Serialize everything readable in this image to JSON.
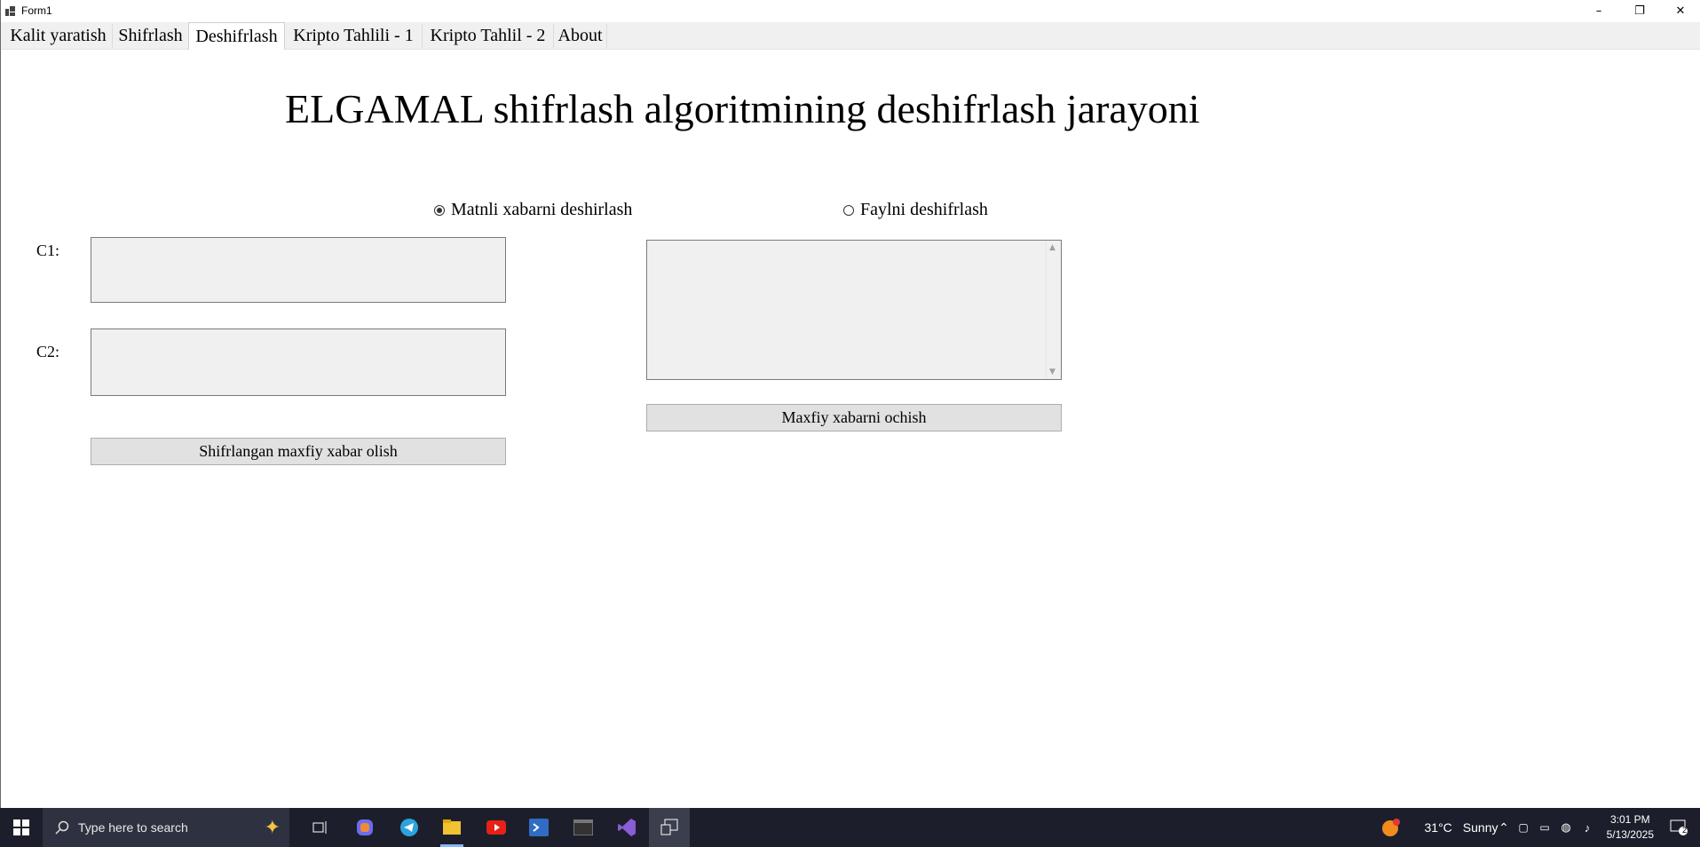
{
  "window": {
    "title": "Form1",
    "controls": {
      "minimize": "–",
      "restore": "❐",
      "close": "✕"
    }
  },
  "tabs": [
    {
      "label": "Kalit yaratish",
      "active": false
    },
    {
      "label": "Shifrlash",
      "active": false
    },
    {
      "label": "Deshifrlash",
      "active": true
    },
    {
      "label": "Kripto Tahlili - 1",
      "active": false
    },
    {
      "label": "Kripto Tahlil - 2",
      "active": false
    },
    {
      "label": "About",
      "active": false
    }
  ],
  "main": {
    "heading": "ELGAMAL shifrlash algoritmining deshifrlash jarayoni",
    "radio_text": {
      "label": "Matnli xabarni deshirlash",
      "checked": true
    },
    "radio_file": {
      "label": "Faylni deshifrlash",
      "checked": false
    },
    "c1_label": "C1:",
    "c1_value": "",
    "c2_label": "C2:",
    "c2_value": "",
    "output_value": "",
    "get_button": "Shifrlangan maxfiy xabar olish",
    "open_button": "Maxfiy xabarni ochish"
  },
  "taskbar": {
    "search_placeholder": "Type here to search",
    "weather_temp": "31°C",
    "weather_desc": "Sunny",
    "time": "3:01 PM",
    "date": "5/13/2025",
    "notification_count": "2"
  },
  "colors": {
    "taskbar_bg": "#1c1f2b",
    "tab_bg": "#f0f0f0",
    "field_bg": "#f0f0f0",
    "button_bg": "#e1e1e1"
  }
}
